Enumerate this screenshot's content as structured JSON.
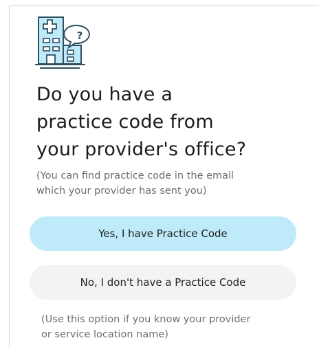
{
  "icon": "clinic-question-icon",
  "accent_color": "#bfeaf9",
  "question": {
    "line1": "Do you have a",
    "line2": "practice code from",
    "line3": "your provider's office?"
  },
  "hint": {
    "line1": "(You can find practice code in the email",
    "line2": "which your provider has sent you)"
  },
  "buttons": {
    "yes_label": "Yes, I have Practice Code",
    "no_label": "No, I don't have a Practice Code"
  },
  "note": {
    "line1": "(Use this option if you know your provider",
    "line2": "or service location name)"
  }
}
